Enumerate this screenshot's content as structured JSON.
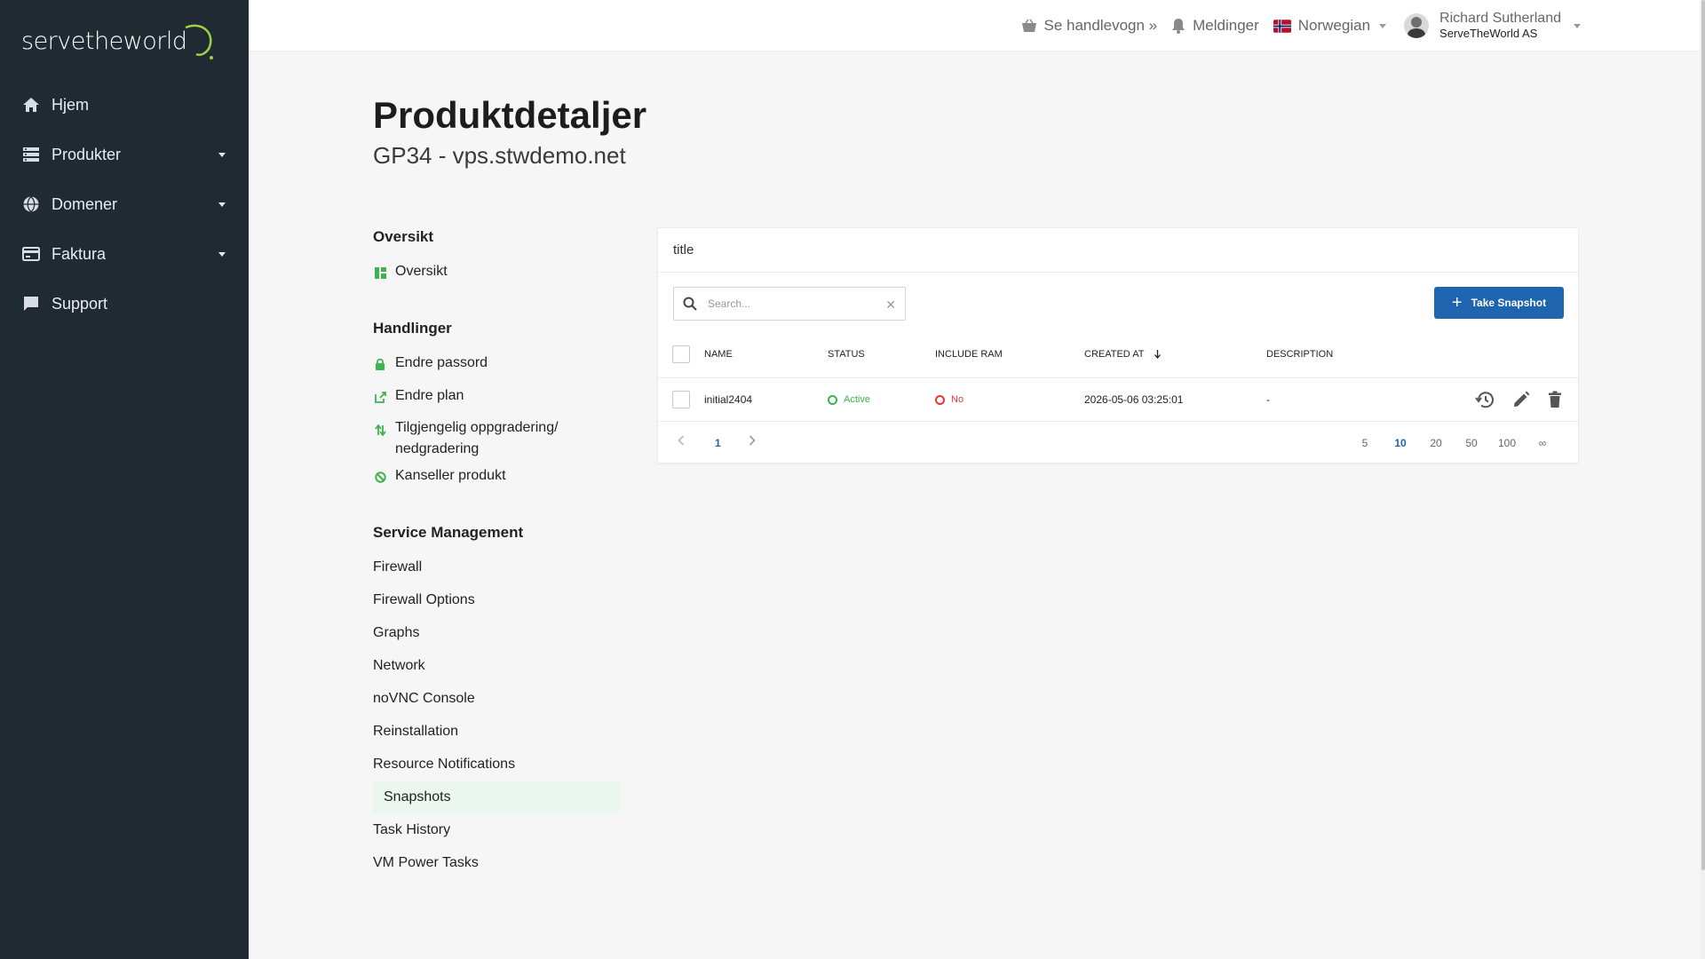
{
  "sidebar": {
    "logo_text": "servetheworld",
    "items": [
      {
        "label": "Hjem",
        "icon": "home-icon"
      },
      {
        "label": "Produkter",
        "icon": "server-icon"
      },
      {
        "label": "Domener",
        "icon": "globe-icon"
      },
      {
        "label": "Faktura",
        "icon": "credit-card-icon"
      },
      {
        "label": "Support",
        "icon": "chat-icon"
      }
    ]
  },
  "topbar": {
    "cart": "Se handlevogn »",
    "notifications": "Meldinger",
    "language": "Norwegian",
    "user_name": "Richard Sutherland",
    "user_company": "ServeTheWorld AS"
  },
  "page": {
    "title": "Produktdetaljer",
    "subtitle": "GP34 - vps.stwdemo.net"
  },
  "menu": {
    "overview_heading": "Oversikt",
    "overview_link": "Oversikt",
    "actions_heading": "Handlinger",
    "actions": [
      "Endre passord",
      "Endre plan",
      "Tilgjengelig oppgradering/ nedgradering",
      "Kanseller produkt"
    ],
    "service_heading": "Service Management",
    "service": [
      "Firewall",
      "Firewall Options",
      "Graphs",
      "Network",
      "noVNC Console",
      "Reinstallation",
      "Resource Notifications",
      "Snapshots",
      "Task History",
      "VM Power Tasks"
    ]
  },
  "card": {
    "title": "title",
    "search_placeholder": "Search...",
    "take_snapshot": "Take Snapshot",
    "columns": [
      "NAME",
      "STATUS",
      "INCLUDE RAM",
      "CREATED AT",
      "DESCRIPTION"
    ],
    "rows": [
      {
        "name": "initial2404",
        "status": "Active",
        "include_ram": "No",
        "created_at": "2026-05-06 03:25:01",
        "description": "-"
      }
    ],
    "pager": {
      "current": "1",
      "sizes": [
        "5",
        "10",
        "20",
        "50",
        "100",
        "∞"
      ],
      "selected_size": "10"
    }
  },
  "colors": {
    "sidebar": "#1f2a32",
    "accent_green": "#3fb34f",
    "primary_blue": "#1f64ae",
    "danger_red": "#e53935"
  }
}
